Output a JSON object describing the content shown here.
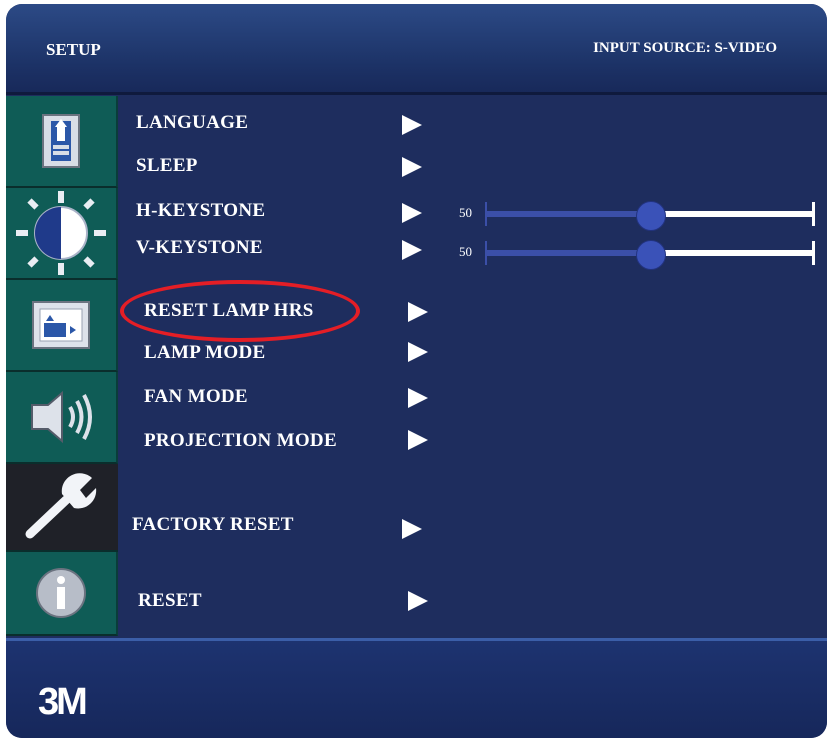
{
  "header": {
    "title": "SETUP",
    "input_source": "INPUT SOURCE: S-VIDEO"
  },
  "sidebar": {
    "tabs": [
      {
        "icon": "image-adjust-icon",
        "active": false
      },
      {
        "icon": "brightness-contrast-icon",
        "active": false
      },
      {
        "icon": "screen-position-icon",
        "active": false
      },
      {
        "icon": "audio-speaker-icon",
        "active": false
      },
      {
        "icon": "wrench-icon",
        "active": true
      },
      {
        "icon": "info-icon",
        "active": false
      }
    ]
  },
  "menu": {
    "language": "LANGUAGE",
    "sleep": "SLEEP",
    "h_keystone": "H-KEYSTONE",
    "v_keystone": "V-KEYSTONE",
    "reset_lamp_hrs": "RESET LAMP HRS",
    "lamp_mode": "LAMP MODE",
    "fan_mode": "FAN MODE",
    "projection_mode": "PROJECTION MODE",
    "factory_reset": "FACTORY RESET",
    "reset": "RESET"
  },
  "sliders": {
    "h_keystone": {
      "value": "50",
      "level": 0.5
    },
    "v_keystone": {
      "value": "50",
      "level": 0.5
    }
  },
  "annotation": {
    "highlighted_item": "RESET LAMP HRS",
    "color": "#e41e26"
  },
  "footer": {
    "logo": "3M"
  },
  "colors": {
    "background": "#1e2d5e",
    "tab": "#0f5c56",
    "slider_fill": "#3b4fa8"
  }
}
